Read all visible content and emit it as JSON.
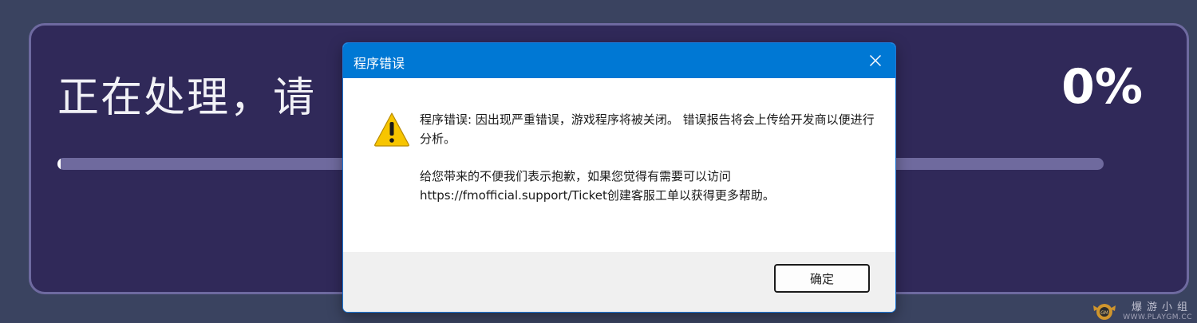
{
  "background": {
    "page_color": "#3a4360",
    "panel_color": "#302959",
    "processing_text": "正在处理，请",
    "percent": "0%",
    "progress": 0
  },
  "dialog": {
    "title": "程序错误",
    "icon": "warning-icon",
    "close_icon": "close-icon",
    "message_line1": "程序错误: 因出现严重错误，游戏程序将被关闭。 错误报告将会上传给开发商以便进行分析。",
    "message_line2": "给您带来的不便我们表示抱歉，如果您觉得有需要可以访问https://fmofficial.support/Ticket创建客服工单以获得更多帮助。",
    "ok_label": "确定",
    "accent_color": "#0078d4"
  },
  "watermark": {
    "main": "爆游小组",
    "sub": "WWW.PLAYGM.CC"
  }
}
